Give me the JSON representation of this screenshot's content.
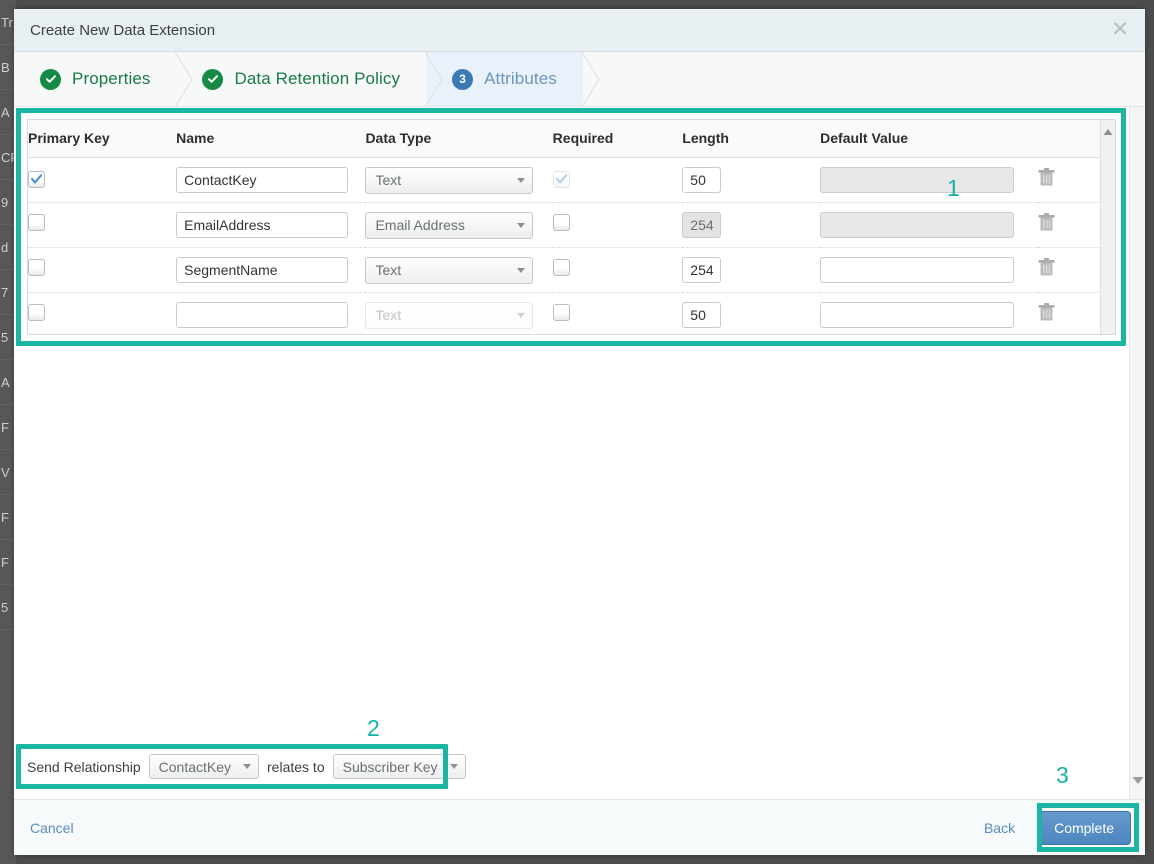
{
  "window": {
    "title": "Create New Data Extension",
    "close_icon": "close-icon"
  },
  "steps": [
    {
      "label": "Properties",
      "state": "done",
      "icon": "check-circle-icon",
      "number": ""
    },
    {
      "label": "Data Retention Policy",
      "state": "done",
      "icon": "check-circle-icon",
      "number": ""
    },
    {
      "label": "Attributes",
      "state": "active",
      "icon": "number-badge",
      "number": "3"
    }
  ],
  "attributes_table": {
    "columns": [
      "Primary Key",
      "Name",
      "Data Type",
      "Required",
      "Length",
      "Default Value"
    ],
    "delete_icon": "trash-icon",
    "rows": [
      {
        "primary_key": true,
        "primary_key_disabled": false,
        "name": "ContactKey",
        "name_placeholder": "",
        "data_type": "Text",
        "data_type_disabled": false,
        "required": true,
        "required_disabled": true,
        "length": "50",
        "length_disabled": false,
        "default_value": "",
        "default_placeholder": "",
        "default_disabled": true
      },
      {
        "primary_key": false,
        "primary_key_disabled": false,
        "name": "EmailAddress",
        "name_placeholder": "",
        "data_type": "Email Address",
        "data_type_disabled": false,
        "required": false,
        "required_disabled": false,
        "length": "254",
        "length_disabled": true,
        "default_value": "",
        "default_placeholder": "",
        "default_disabled": true
      },
      {
        "primary_key": false,
        "primary_key_disabled": false,
        "name": "SegmentName",
        "name_placeholder": "",
        "data_type": "Text",
        "data_type_disabled": false,
        "required": false,
        "required_disabled": false,
        "length": "254",
        "length_disabled": false,
        "default_value": "",
        "default_placeholder": "",
        "default_disabled": false
      },
      {
        "primary_key": false,
        "primary_key_disabled": false,
        "name": "",
        "name_placeholder": "",
        "data_type": "Text",
        "data_type_disabled": true,
        "required": false,
        "required_disabled": false,
        "length": "50",
        "length_disabled": false,
        "default_value": "",
        "default_placeholder": "",
        "default_disabled": false
      }
    ]
  },
  "send_relationship": {
    "prefix_label": "Send Relationship",
    "field_value": "ContactKey",
    "middle_label": "relates to",
    "target_value": "Subscriber Key"
  },
  "footer": {
    "cancel_label": "Cancel",
    "back_label": "Back",
    "complete_label": "Complete"
  },
  "annotations": {
    "one": "1",
    "two": "2",
    "three": "3",
    "highlight_color": "#1bb5a4"
  },
  "background_sliver_rows": [
    "Tr",
    "B",
    "A",
    "CF",
    "9",
    "d",
    "7",
    "5",
    "A",
    "F",
    "V",
    "F",
    "F",
    "5"
  ]
}
